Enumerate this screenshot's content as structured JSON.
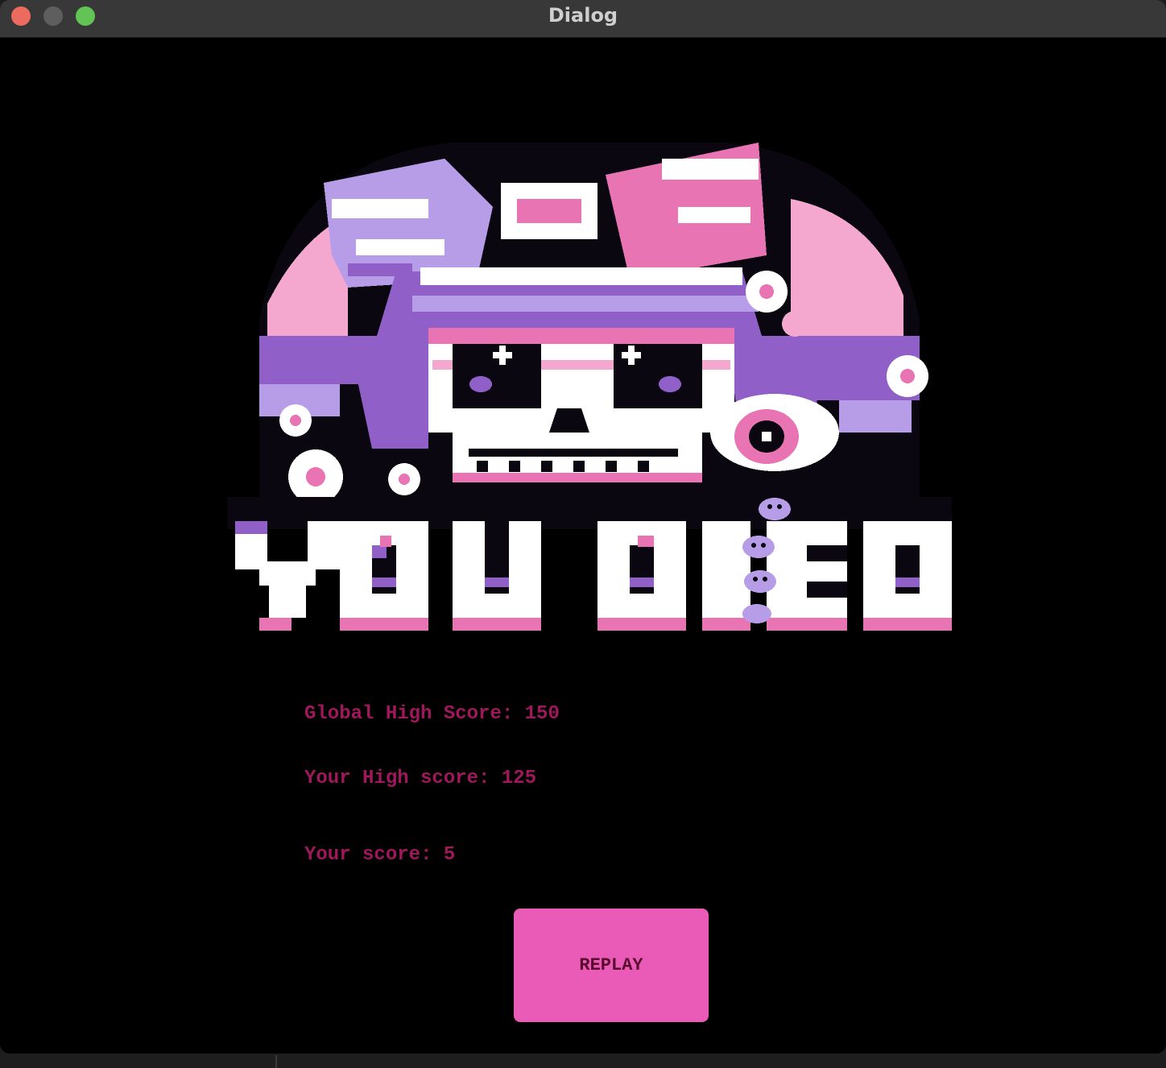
{
  "window": {
    "title": "Dialog"
  },
  "art": {
    "caption": "YOU DIED",
    "palette": {
      "white": "#ffffff",
      "pink": "#e874b4",
      "light_pink": "#f4a8cf",
      "purple": "#9060c8",
      "lavender": "#b79de8",
      "dark": "#0a0710"
    }
  },
  "scores": {
    "global_high": "Global High Score: 150",
    "your_high": "Your High score: 125",
    "your_score": "Your score: 5"
  },
  "buttons": {
    "replay": "REPLAY"
  },
  "colors": {
    "score_text": "#a0185c",
    "button_bg": "#e95bb6",
    "button_text": "#5a0a2e"
  }
}
